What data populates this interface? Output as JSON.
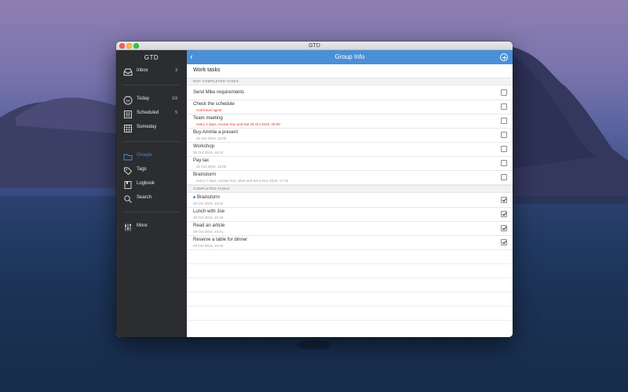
{
  "window": {
    "title": "GTD"
  },
  "sidebar": {
    "header": "GTD",
    "items": [
      {
        "label": "Inbox",
        "count": "3",
        "icon": "inbox-icon"
      },
      {
        "label": "Today",
        "count": "1/3",
        "icon": "calendar-24-icon"
      },
      {
        "label": "Scheduled",
        "count": "5",
        "icon": "scheduled-list-icon"
      },
      {
        "label": "Someday",
        "count": "",
        "icon": "grid-calendar-icon"
      },
      {
        "label": "Groups",
        "count": "",
        "icon": "folder-icon",
        "active": true
      },
      {
        "label": "Tags",
        "count": "",
        "icon": "tag-icon"
      },
      {
        "label": "Logbook",
        "count": "",
        "icon": "book-icon"
      },
      {
        "label": "Search",
        "count": "",
        "icon": "search-icon"
      },
      {
        "label": "More",
        "count": "",
        "icon": "sliders-icon"
      }
    ]
  },
  "nav": {
    "back_label": "‹",
    "title": "Group Info",
    "add_icon": "add-circle-icon"
  },
  "group": {
    "title": "Work tasks"
  },
  "sections": {
    "not_completed": "NOT COMPLETED TASKS",
    "completed": "COMPLETED TASKS"
  },
  "not_completed_tasks": [
    {
      "name": "Send Mike requirements",
      "sub": "",
      "checked": false
    },
    {
      "name": "Check the schedule",
      "sub": "Call travel agent",
      "sub_red": true,
      "checked": false
    },
    {
      "name": "Team meeting",
      "sub": "every 2 days, except Sun and Sat 28 Oct 2019, 09:00",
      "sub_red": true,
      "checked": false
    },
    {
      "name": "Buy Ammie a present",
      "sub": "30 Oct 2019, 10:00",
      "checked": false
    },
    {
      "name": "Workshop",
      "sub": "30 Oct 2019, 16:10",
      "checked": false
    },
    {
      "name": "Pay tax",
      "sub": "31 Oct 2019, 12:00",
      "checked": false
    },
    {
      "name": "Brainstorm",
      "sub": "every 2 days, except Sun, Wed and Sat 6 Nov 2019, 17:15",
      "checked": false
    }
  ],
  "completed_tasks": [
    {
      "name": "Brainstorm",
      "sub": "29 Oct 2019, 10:22",
      "dot": true,
      "checked": true
    },
    {
      "name": "Lunch with Joe",
      "sub": "29 Oct 2019, 10:16",
      "checked": true
    },
    {
      "name": "Read an article",
      "sub": "29 Oct 2019, 10:21",
      "checked": true
    },
    {
      "name": "Reserve a table for dinner",
      "sub": "29 Oct 2019, 10:16",
      "checked": true
    }
  ],
  "colors": {
    "accent": "#4a8fd8",
    "sidebar": "#2b2d30",
    "alert": "#e0352b"
  }
}
